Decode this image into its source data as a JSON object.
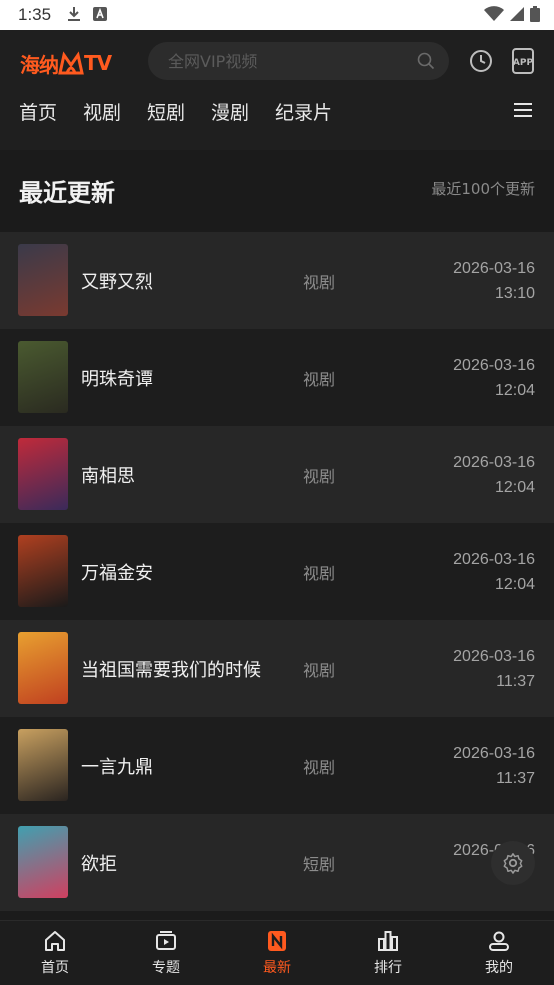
{
  "status_bar": {
    "time": "1:35"
  },
  "header": {
    "logo_text": "海纳",
    "logo_tv": "TV",
    "search_placeholder": "全网VIP视频",
    "nav_tabs": [
      "首页",
      "视剧",
      "短剧",
      "漫剧",
      "纪录片"
    ]
  },
  "section": {
    "title": "最近更新",
    "subtitle": "最近100个更新"
  },
  "items": [
    {
      "title": "又野又烈",
      "category": "视剧",
      "date": "2026-03-16",
      "time": "13:10",
      "poster_colors": [
        "#3a3a4a",
        "#7a3a30"
      ]
    },
    {
      "title": "明珠奇谭",
      "category": "视剧",
      "date": "2026-03-16",
      "time": "12:04",
      "poster_colors": [
        "#4a5a30",
        "#2a2a20"
      ]
    },
    {
      "title": "南相思",
      "category": "视剧",
      "date": "2026-03-16",
      "time": "12:04",
      "poster_colors": [
        "#c02a3a",
        "#3a2a5a"
      ]
    },
    {
      "title": "万福金安",
      "category": "视剧",
      "date": "2026-03-16",
      "time": "12:04",
      "poster_colors": [
        "#b04020",
        "#1a1a1a"
      ]
    },
    {
      "title": "当祖国需要我们的时候",
      "category": "视剧",
      "date": "2026-03-16",
      "time": "11:37",
      "poster_colors": [
        "#e8a030",
        "#c04020"
      ]
    },
    {
      "title": "一言九鼎",
      "category": "视剧",
      "date": "2026-03-16",
      "time": "11:37",
      "poster_colors": [
        "#c8a060",
        "#2a2420"
      ]
    },
    {
      "title": "欲拒",
      "category": "短剧",
      "date": "2026-03-16",
      "time": "",
      "poster_colors": [
        "#40a0b0",
        "#d04060"
      ]
    }
  ],
  "bottom_nav": [
    {
      "label": "首页",
      "icon": "home-icon",
      "active": false
    },
    {
      "label": "专题",
      "icon": "topic-icon",
      "active": false
    },
    {
      "label": "最新",
      "icon": "latest-icon",
      "active": true
    },
    {
      "label": "排行",
      "icon": "rank-icon",
      "active": false
    },
    {
      "label": "我的",
      "icon": "profile-icon",
      "active": false
    }
  ],
  "colors": {
    "accent": "#ff5a1f",
    "background": "#1b1b1b",
    "row_alt": "#272727"
  }
}
